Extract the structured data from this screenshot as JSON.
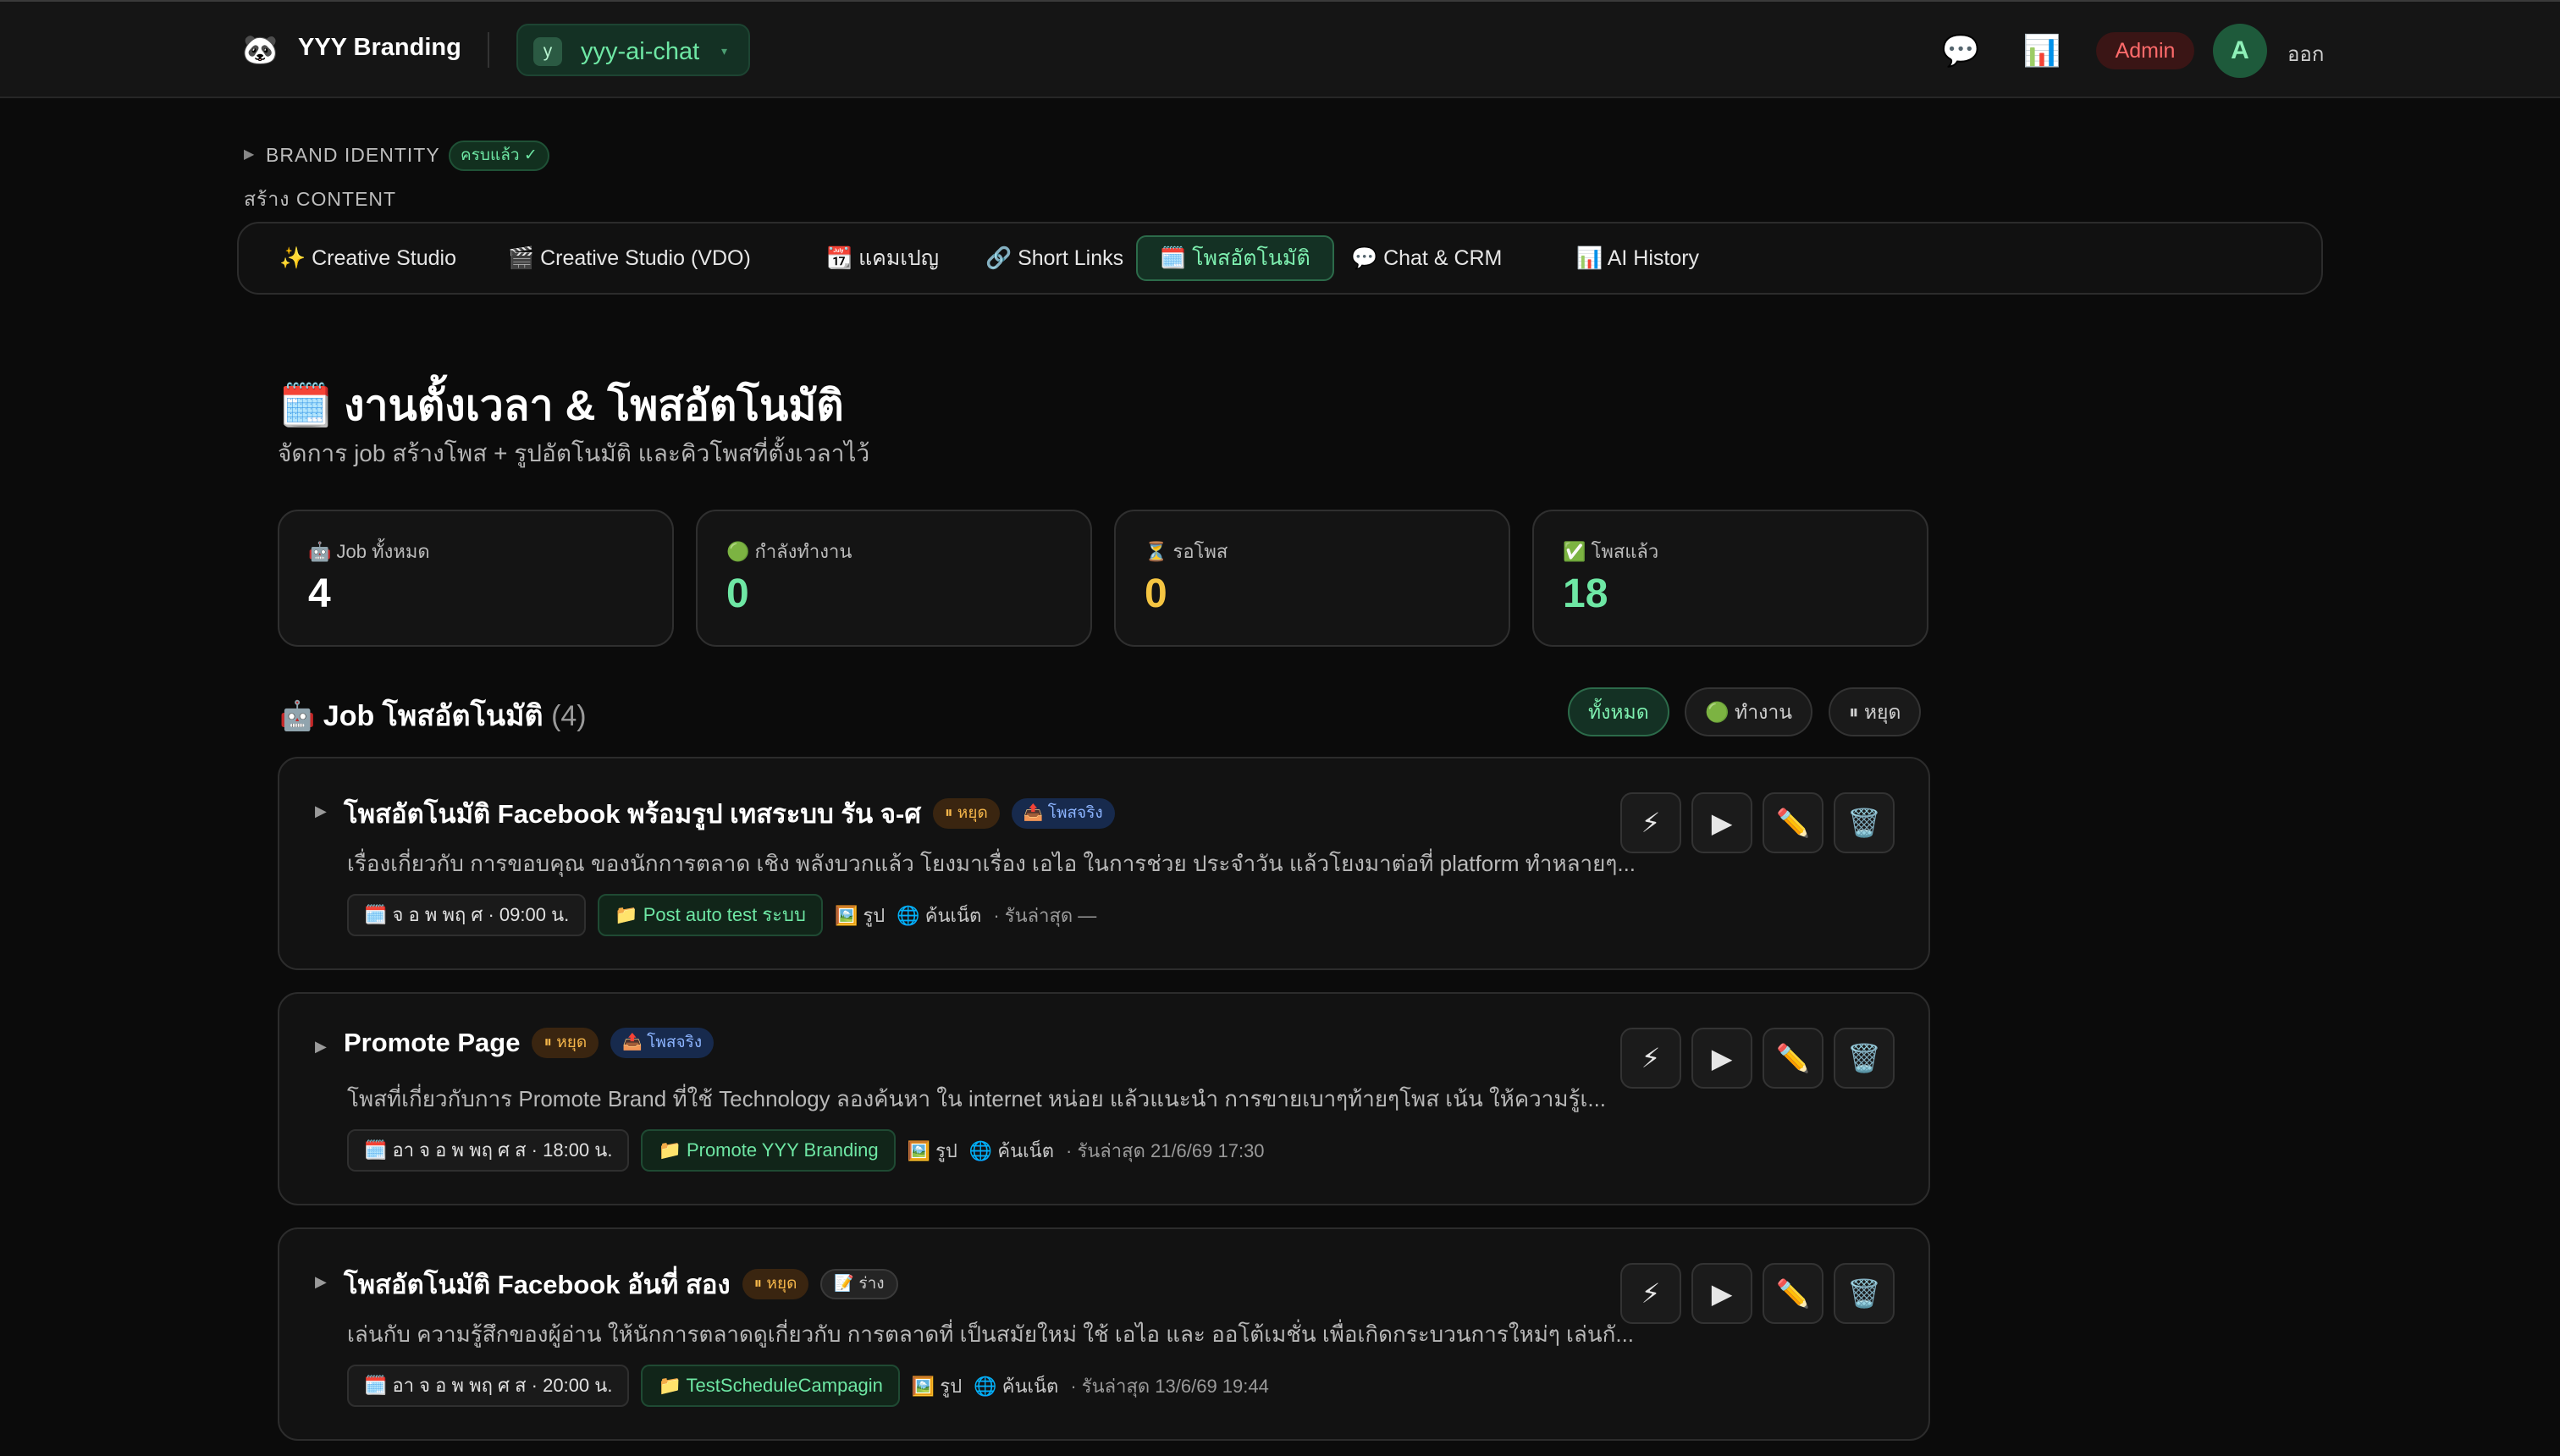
{
  "topbar": {
    "brand_name": "YYY Branding",
    "brand_logo": "🐼",
    "workspace": {
      "avatar_letter": "y",
      "name": "yyy-ai-chat",
      "caret": "▾"
    },
    "chat_icon": "💬",
    "analytics_icon": "📊",
    "admin_label": "Admin",
    "user_initial": "A",
    "logout_label": "ออก"
  },
  "brand_identity": {
    "caret": "▶",
    "label": "BRAND IDENTITY",
    "status": "ครบแล้ว ✓"
  },
  "create_content_label": "สร้าง CONTENT",
  "tabs": [
    {
      "label": "✨ Creative Studio"
    },
    {
      "label": "🎬 Creative Studio (VDO)"
    },
    {
      "label": "📆 แคมเปญ"
    },
    {
      "label": "🔗 Short Links"
    },
    {
      "label": "🗓️ โพสอัตโนมัติ"
    },
    {
      "label": "💬 Chat & CRM"
    },
    {
      "label": "📊 AI History"
    }
  ],
  "page": {
    "title": "🗓️ งานตั้งเวลา & โพสอัตโนมัติ",
    "subtitle": "จัดการ job สร้างโพส + รูปอัตโนมัติ และคิวโพสที่ตั้งเวลาไว้"
  },
  "stats": [
    {
      "label": "🤖 Job ทั้งหมด",
      "value": "4",
      "color": "#ffffff"
    },
    {
      "label": "🟢 กำลังทำงาน",
      "value": "0",
      "color": "#6ee7a4"
    },
    {
      "label": "⏳ รอโพส",
      "value": "0",
      "color": "#f5c542"
    },
    {
      "label": "✅ โพสแล้ว",
      "value": "18",
      "color": "#6ee7a4"
    }
  ],
  "section": {
    "title": "🤖 Job โพสอัตโนมัติ",
    "count": "(4)"
  },
  "filters": [
    {
      "label": "ทั้งหมด"
    },
    {
      "label": "🟢 ทำงาน"
    },
    {
      "label": "⏸ หยุด"
    }
  ],
  "actions": {
    "run_now": "⚡",
    "play": "▶",
    "edit": "✏️",
    "delete": "🗑️"
  },
  "jobs": [
    {
      "title": "โพสอัตโนมัติ Facebook พร้อมรูป เทสระบบ รัน จ-ศ",
      "status": "⏸ หยุด",
      "mode": "📤 โพสจริง",
      "mode_type": "real",
      "description": "เรื่องเกี่ยวกับ การขอบคุณ ของนักการตลาด เชิง พลังบวกแล้ว โยงมาเรื่อง เอไอ ในการช่วย ประจำวัน แล้วโยงมาต่อที่ platform ทำหลายๆ...",
      "schedule": "🗓️ จ อ พ พฤ ศ · 09:00 น.",
      "folder": "📁 Post auto test ระบบ",
      "image": "🖼️ รูป",
      "source": "🌐 ค้นเน็ต",
      "last_run": "· รันล่าสุด —"
    },
    {
      "title": "Promote Page",
      "status": "⏸ หยุด",
      "mode": "📤 โพสจริง",
      "mode_type": "real",
      "description": "โพสที่เกี่ยวกับการ Promote Brand ที่ใช้ Technology ลองค้นหา ใน internet หน่อย แล้วแนะนำ การขายเบาๆท้ายๆโพส เน้น ให้ความรู้เ...",
      "schedule": "🗓️ อา จ อ พ พฤ ศ ส · 18:00 น.",
      "folder": "📁 Promote YYY Branding",
      "image": "🖼️ รูป",
      "source": "🌐 ค้นเน็ต",
      "last_run": "· รันล่าสุด 21/6/69 17:30"
    },
    {
      "title": "โพสอัตโนมัติ Facebook อันที่ สอง",
      "status": "⏸ หยุด",
      "mode": "📝 ร่าง",
      "mode_type": "draft",
      "description": "เล่นกับ ความรู้สึกของผู้อ่าน ให้นักการตลาดดูเกี่ยวกับ การตลาดที่ เป็นสมัยใหม่ ใช้ เอไอ และ ออโต้เมชั่น เพื่อเกิดกระบวนการใหม่ๆ เล่นกั...",
      "schedule": "🗓️ อา จ อ พ พฤ ศ ส · 20:00 น.",
      "folder": "📁 TestScheduleCampagin",
      "image": "🖼️ รูป",
      "source": "🌐 ค้นเน็ต",
      "last_run": "· รันล่าสุด 13/6/69 19:44"
    }
  ]
}
